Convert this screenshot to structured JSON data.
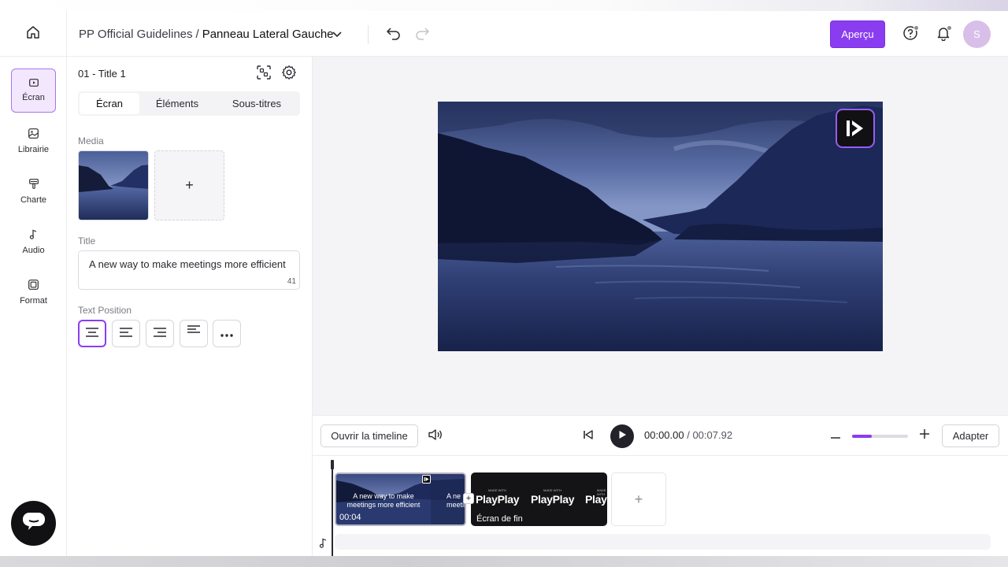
{
  "header": {
    "project_name": "PP Official Guidelines",
    "separator": "/",
    "page_name": "Panneau Lateral Gauche",
    "preview_label": "Aperçu",
    "avatar_initial": "S"
  },
  "nav": {
    "items": [
      {
        "label": "Écran",
        "icon": "screen-icon",
        "active": true
      },
      {
        "label": "Librairie",
        "icon": "library-icon",
        "active": false
      },
      {
        "label": "Charte",
        "icon": "brush-icon",
        "active": false
      },
      {
        "label": "Audio",
        "icon": "music-note-icon",
        "active": false
      },
      {
        "label": "Format",
        "icon": "format-icon",
        "active": false
      }
    ]
  },
  "panel": {
    "screen_title": "01 - Title 1",
    "tabs": [
      "Écran",
      "Éléments",
      "Sous-titres"
    ],
    "active_tab": "Écran",
    "media_label": "Media",
    "media_add": "+",
    "title_label": "Title",
    "title_value": "A new way to make meetings more efficient",
    "title_char_count": "41",
    "text_position_label": "Text Position"
  },
  "controls": {
    "open_timeline": "Ouvrir la timeline",
    "current_time": "00:00.00",
    "time_separator": " / ",
    "total_time": "00:07.92",
    "zoom_level": 0.35,
    "fit_label": "Adapter"
  },
  "timeline": {
    "clips": [
      {
        "caption_line1": "A new way to make",
        "caption_line2": "meetings more efficient",
        "caption_partial1": "A ne",
        "caption_partial2": "meetin",
        "duration": "00:04"
      },
      {
        "brand_text": "PlayPlay",
        "brand_small": "MADE WITH",
        "label": "Écran de fin"
      }
    ],
    "join_symbol": "+",
    "add_symbol": "+"
  },
  "colors": {
    "accent": "#8a3df0",
    "accent_light": "#f2e7fd"
  }
}
